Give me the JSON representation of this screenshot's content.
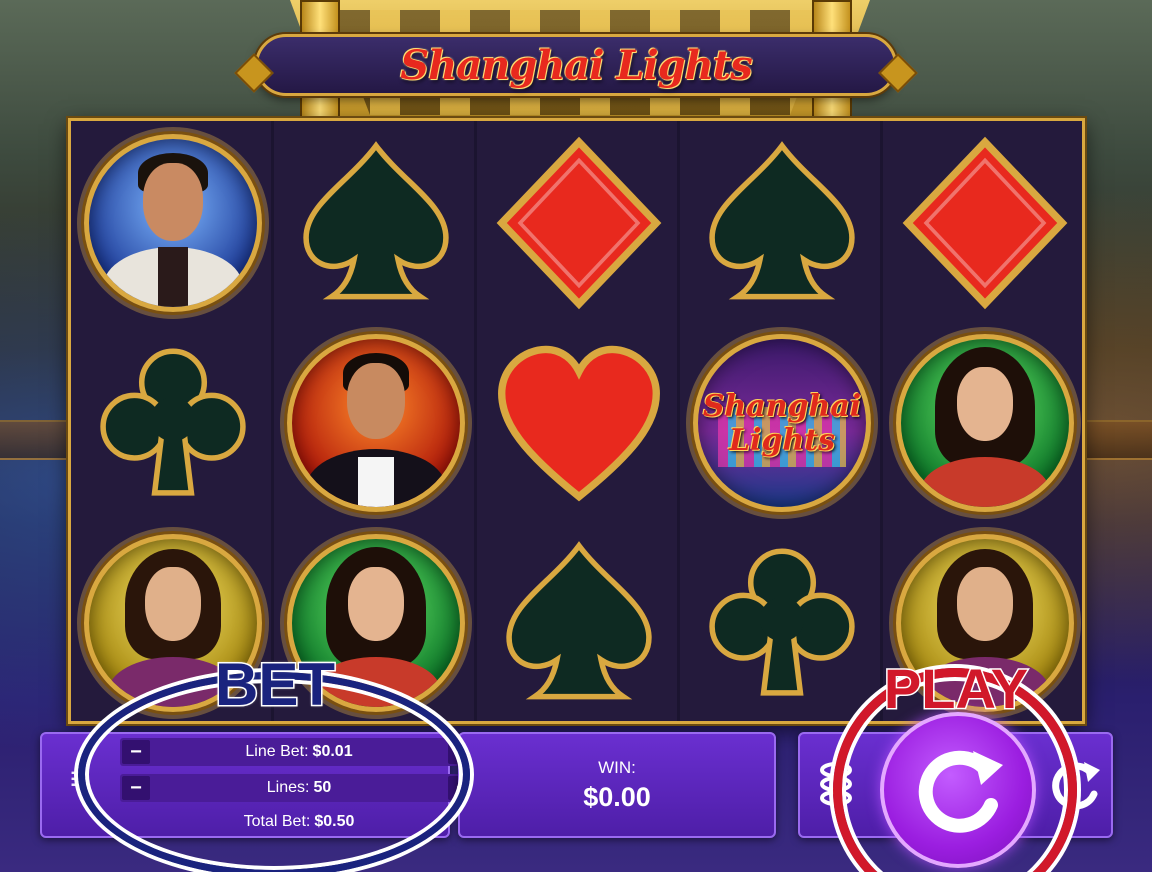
{
  "game": {
    "title": "Shanghai Lights"
  },
  "reels": [
    [
      "portrait-man-white-suit",
      "club",
      "portrait-woman-cocktail"
    ],
    [
      "spade",
      "portrait-man-tuxedo",
      "portrait-woman-champagne"
    ],
    [
      "diamond",
      "heart",
      "spade"
    ],
    [
      "spade",
      "logo-shanghai-lights",
      "club"
    ],
    [
      "diamond",
      "portrait-woman-champagne",
      "portrait-woman-cocktail"
    ]
  ],
  "logo_symbol": {
    "line1": "Shanghai",
    "line2": "Lights"
  },
  "bet_panel": {
    "line_bet_label": "Line Bet:",
    "line_bet_value": "$0.01",
    "lines_label": "Lines:",
    "lines_value": "50",
    "total_bet_label": "Total Bet:",
    "total_bet_value": "$0.50",
    "minus": "−",
    "plus": "+"
  },
  "win_panel": {
    "label": "WIN:",
    "value": "$0.00"
  },
  "annotations": {
    "bet_label": "BET",
    "play_label": "PLAY",
    "bet_color": "#1a237e",
    "play_color": "#d1182a"
  },
  "icons": {
    "spin": "refresh-icon",
    "coins": "coin-stack-icon",
    "autoplay": "autoplay-icon",
    "menu": "menu-icon"
  },
  "colors": {
    "gold": "#d9a840",
    "panel_purple": "#5a24b8",
    "spin_purple": "#9b1ee0",
    "suit_red": "#e8291e",
    "suit_dark": "#0e2a22"
  }
}
